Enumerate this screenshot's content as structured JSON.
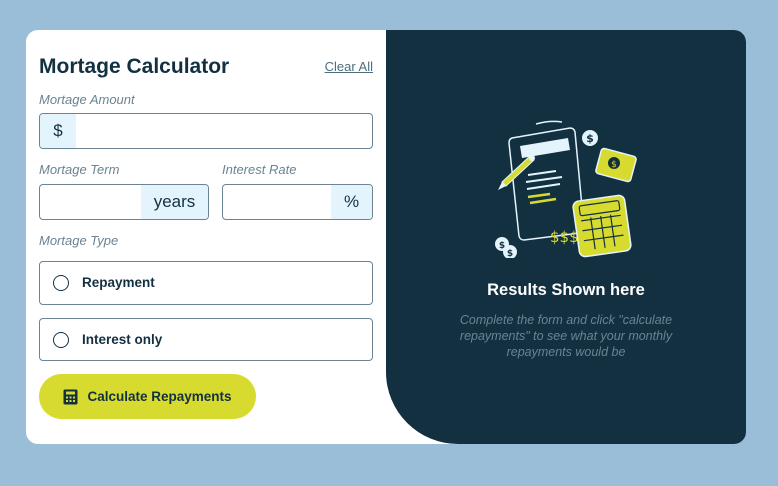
{
  "form": {
    "title": "Mortage Calculator",
    "clear_label": "Clear All",
    "amount": {
      "label": "Mortage Amount",
      "prefix": "$",
      "value": ""
    },
    "term": {
      "label": "Mortage Term",
      "suffix": "years",
      "value": ""
    },
    "rate": {
      "label": "Interest Rate",
      "suffix": "%",
      "value": ""
    },
    "type": {
      "label": "Mortage Type",
      "options": [
        {
          "label": "Repayment",
          "selected": false
        },
        {
          "label": "Interest only",
          "selected": false
        }
      ]
    },
    "submit_label": "Calculate Repayments"
  },
  "results": {
    "title": "Results Shown here",
    "description": "Complete the form and click \"calculate repayments\" to see what your monthly repayments would be"
  },
  "colors": {
    "background": "#9ABED8",
    "panel": "#133041",
    "accent": "#D8DB2F",
    "addon": "#E4F4FD"
  },
  "icons": [
    "calculator-icon",
    "empty-results-illustration"
  ]
}
